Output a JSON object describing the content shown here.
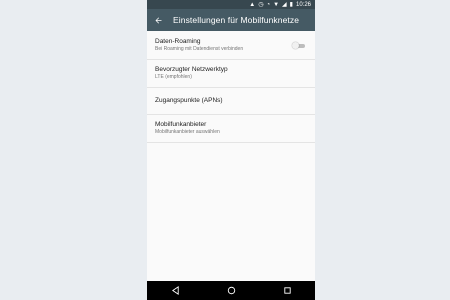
{
  "status_bar": {
    "time": "10:26",
    "icons": [
      "signal-icon",
      "clock-icon",
      "alarm-icon",
      "wifi-icon",
      "cell-signal-icon",
      "battery-icon"
    ]
  },
  "app_bar": {
    "title": "Einstellungen für Mobilfunknetze",
    "back_icon": "arrow-back-icon"
  },
  "settings": [
    {
      "title": "Daten-Roaming",
      "summary": "Bei Roaming mit Datendienst verbinden",
      "toggle": false
    },
    {
      "title": "Bevorzugter Netzwerktyp",
      "summary": "LTE (empfohlen)"
    },
    {
      "title": "Zugangspunkte (APNs)",
      "summary": ""
    },
    {
      "title": "Mobilfunkanbieter",
      "summary": "Mobilfunkanbieter auswählen"
    }
  ],
  "nav_bar": {
    "buttons": [
      "back-triangle-icon",
      "home-circle-icon",
      "recents-square-icon"
    ]
  },
  "colors": {
    "status_bar": "#37474f",
    "app_bar": "#455a64",
    "background": "#fafafa"
  }
}
